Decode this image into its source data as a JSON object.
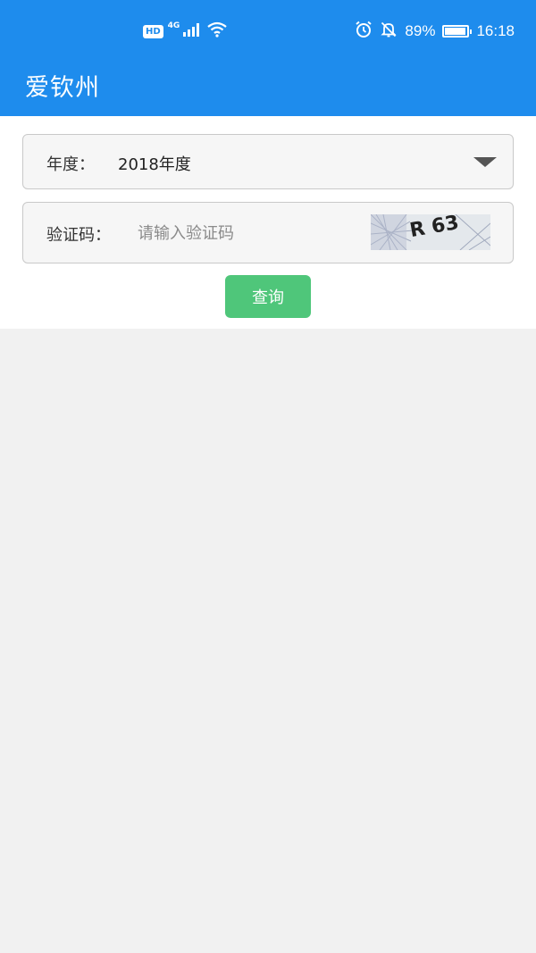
{
  "status_bar": {
    "hd_badge": "HD",
    "network": "4G",
    "battery_percent": "89%",
    "battery_level": 0.89,
    "time": "16:18",
    "icons": [
      "hd-icon",
      "signal-icon",
      "wifi-icon",
      "alarm-icon",
      "mute-bell-icon",
      "battery-icon"
    ]
  },
  "app_bar": {
    "title": "爱钦州"
  },
  "form": {
    "year_label": "年度：",
    "year_value": "2018年度",
    "captcha_label": "验证码：",
    "captcha_placeholder": "请输入验证码",
    "captcha_value": "",
    "captcha_image_text": "R 63",
    "submit_label": "查询"
  },
  "colors": {
    "primary": "#1e8ced",
    "button": "#4fc67a",
    "background": "#f1f1f1"
  }
}
